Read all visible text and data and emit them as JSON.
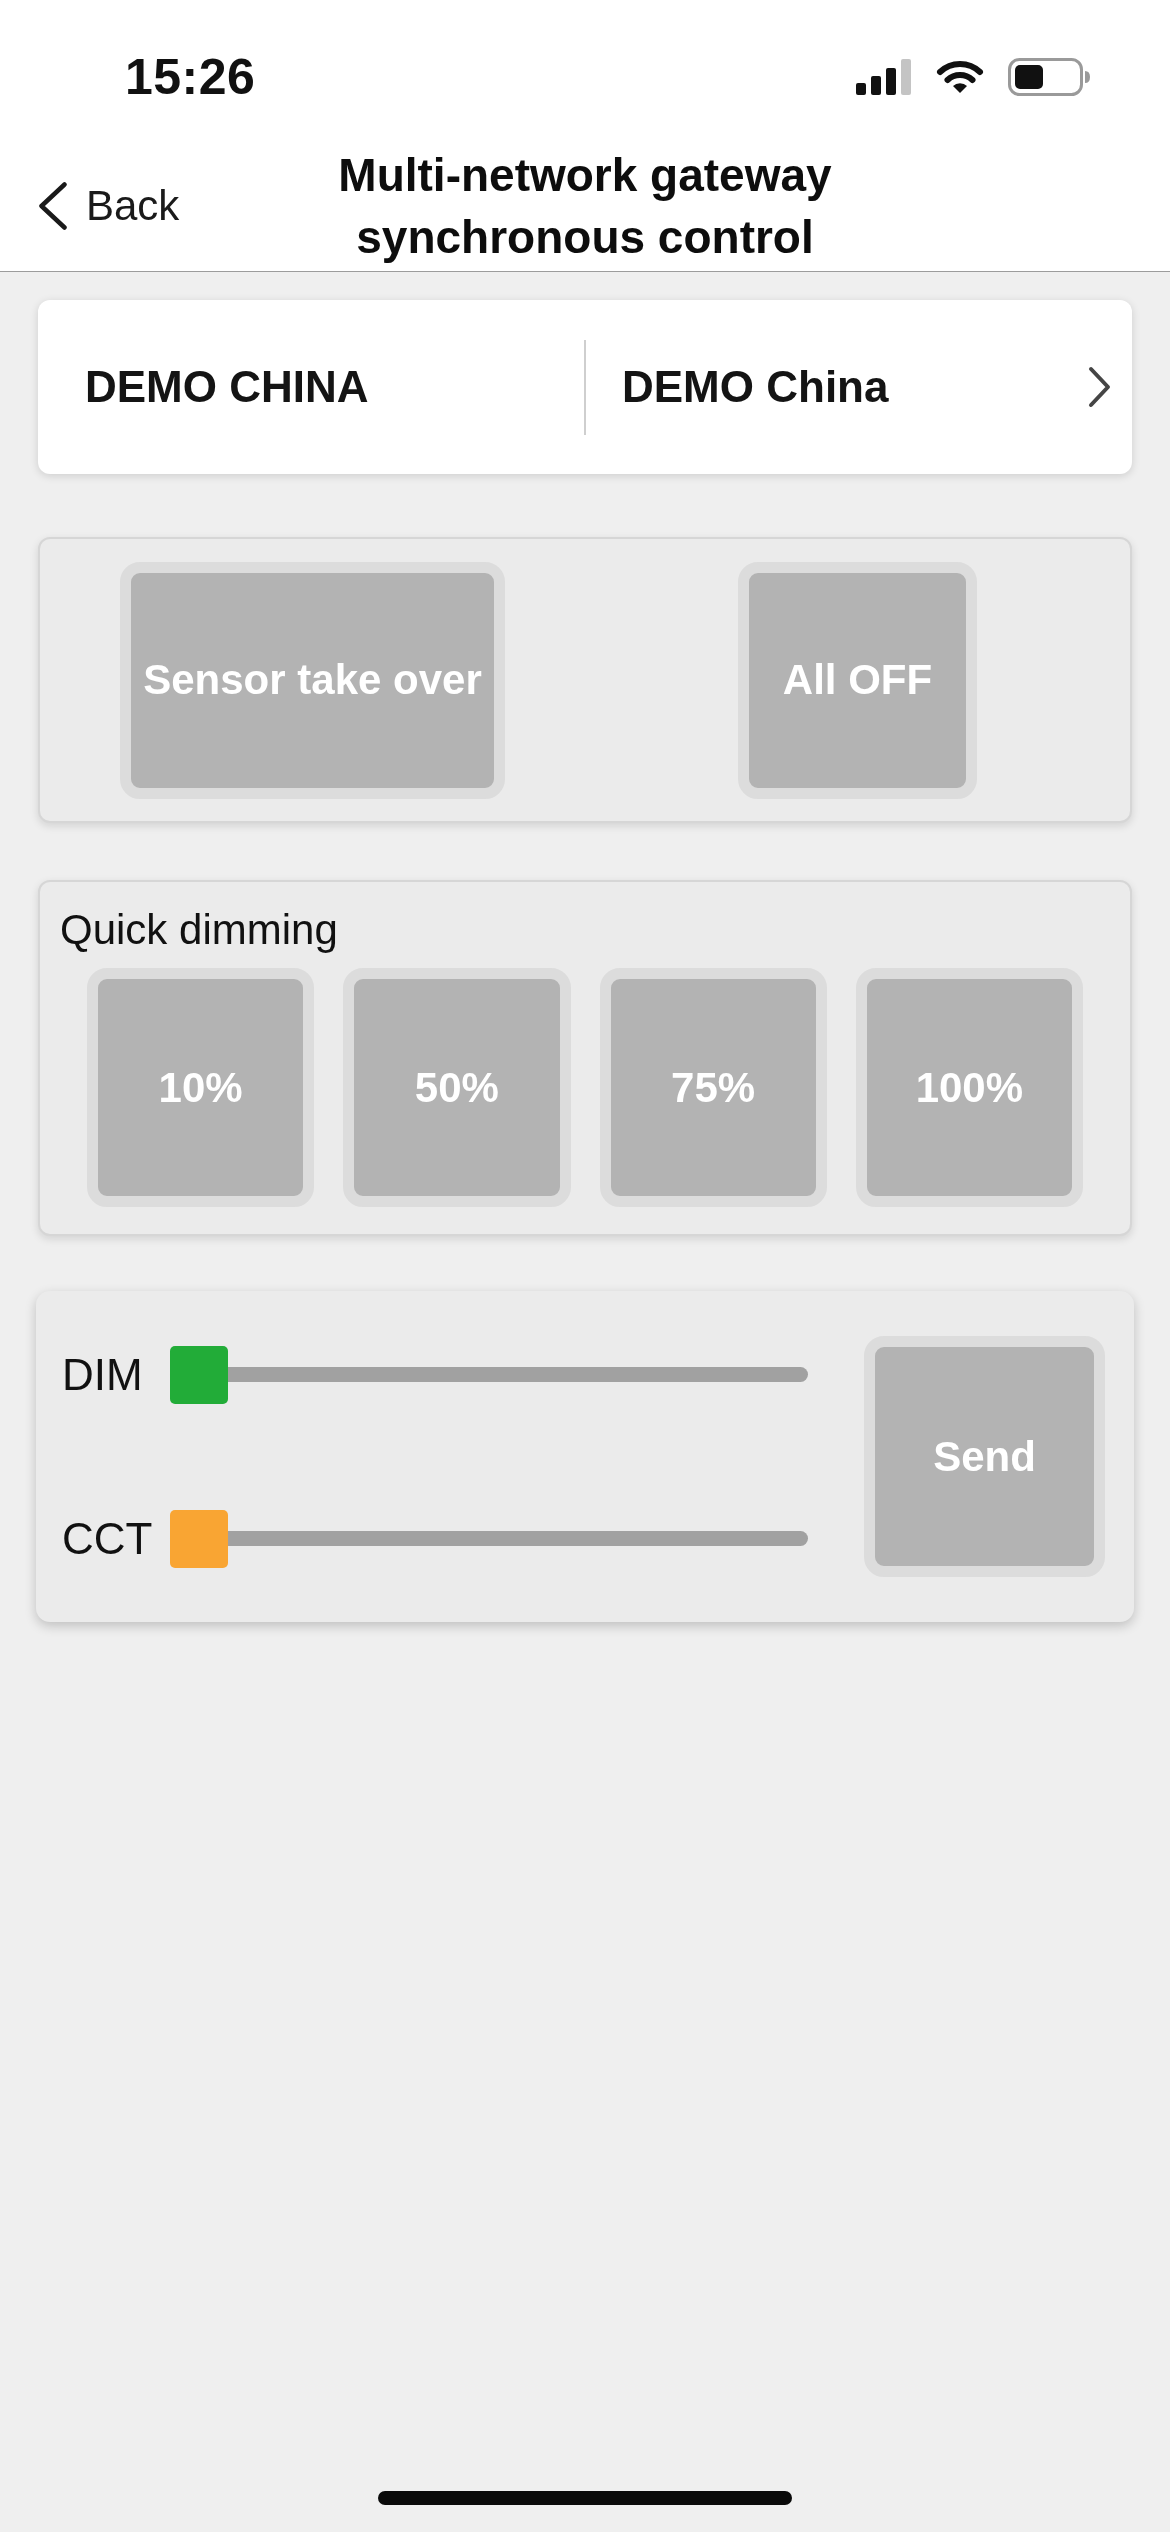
{
  "status_bar": {
    "time": "15:26"
  },
  "nav_bar": {
    "back_label": "Back",
    "title": "Multi-network gateway synchronous control"
  },
  "gateway_selector": {
    "column_1": "DEMO CHINA",
    "column_2": "DEMO China"
  },
  "actions": [
    {
      "label": "Sensor take over"
    },
    {
      "label": "All OFF"
    }
  ],
  "quick_dimming": {
    "title": "Quick dimming",
    "presets": [
      "10%",
      "50%",
      "75%",
      "100%"
    ]
  },
  "sliders": [
    {
      "label": "DIM",
      "level": 0,
      "color": "#22ac38"
    },
    {
      "label": "CCT",
      "level": 0,
      "color": "#f9a533"
    }
  ],
  "send_button": {
    "label": "Send"
  }
}
